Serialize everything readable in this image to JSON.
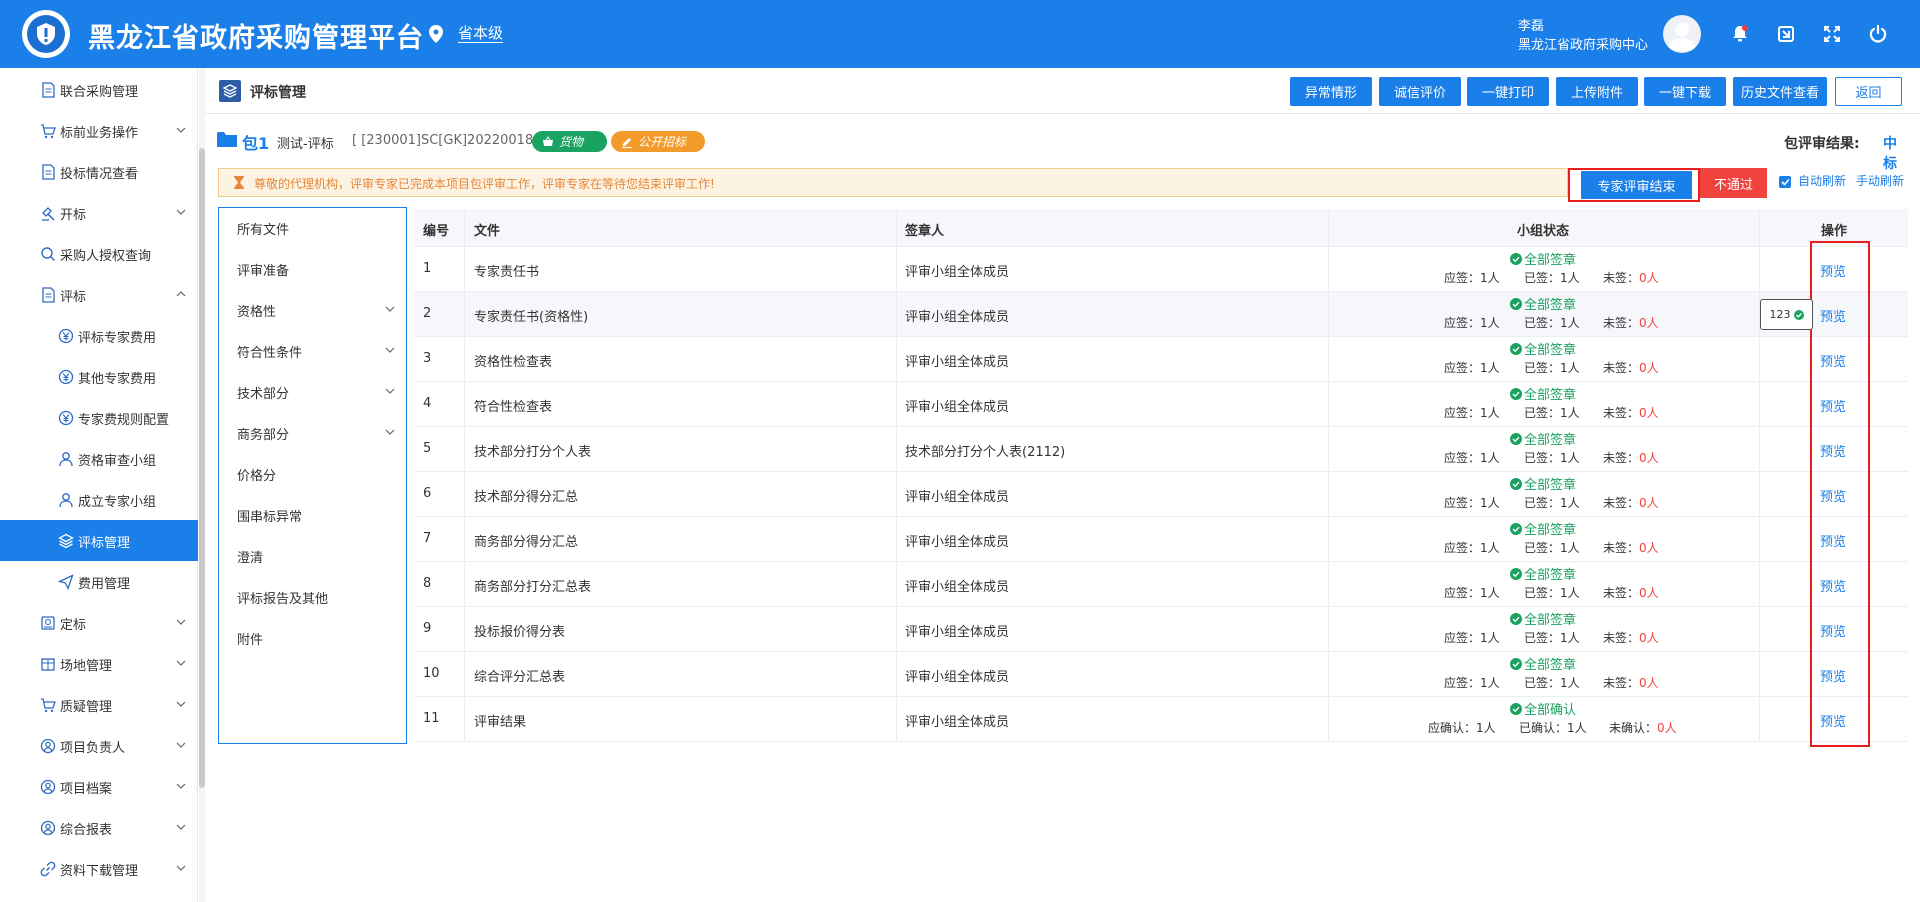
{
  "header": {
    "app_title": "黑龙江省政府采购管理平台",
    "location": "省本级",
    "user_name": "李磊",
    "user_org": "黑龙江省政府采购中心"
  },
  "sidebar": {
    "items": [
      {
        "label": "联合采购管理",
        "icon": "document-icon",
        "has_chevron": false
      },
      {
        "label": "标前业务操作",
        "icon": "cart-icon",
        "has_chevron": true
      },
      {
        "label": "投标情况查看",
        "icon": "document-icon",
        "has_chevron": false
      },
      {
        "label": "开标",
        "icon": "hammer-icon",
        "has_chevron": true
      },
      {
        "label": "采购人授权查询",
        "icon": "search-icon",
        "has_chevron": false
      },
      {
        "label": "评标",
        "icon": "document-icon",
        "has_chevron": true
      },
      {
        "label": "评标专家费用",
        "icon": "yen-icon",
        "has_chevron": false
      },
      {
        "label": "其他专家费用",
        "icon": "yen-icon",
        "has_chevron": false
      },
      {
        "label": "专家费规则配置",
        "icon": "yen-icon",
        "has_chevron": false
      },
      {
        "label": "资格审查小组",
        "icon": "user-icon",
        "has_chevron": false
      },
      {
        "label": "成立专家小组",
        "icon": "user-icon",
        "has_chevron": false
      },
      {
        "label": "评标管理",
        "icon": "layers-icon",
        "has_chevron": false
      },
      {
        "label": "费用管理",
        "icon": "send-icon",
        "has_chevron": false
      },
      {
        "label": "定标",
        "icon": "stamp-icon",
        "has_chevron": true
      },
      {
        "label": "场地管理",
        "icon": "building-icon",
        "has_chevron": true
      },
      {
        "label": "质疑管理",
        "icon": "cart-icon",
        "has_chevron": true
      },
      {
        "label": "项目负责人",
        "icon": "user-circle-icon",
        "has_chevron": true
      },
      {
        "label": "项目档案",
        "icon": "user-circle-icon",
        "has_chevron": true
      },
      {
        "label": "综合报表",
        "icon": "user-circle-icon",
        "has_chevron": true
      },
      {
        "label": "资料下载管理",
        "icon": "link-icon",
        "has_chevron": true
      }
    ]
  },
  "topbar": {
    "title": "评标管理",
    "buttons": [
      "异常情形",
      "诚信评价",
      "一键打印",
      "上传附件",
      "一键下载",
      "历史文件查看"
    ],
    "back_label": "返回"
  },
  "package": {
    "number": "包1",
    "name": "测试-评标",
    "code": "[ [230001]SC[GK]20220018 ]",
    "tag_goods": "货物",
    "tag_method": "公开招标",
    "result_label": "包评审结果:",
    "result_value": "中标"
  },
  "notice": {
    "text": "尊敬的代理机构，评审专家已完成本项目包评审工作，评审专家在等待您结束评审工作!",
    "end_button": "专家评审结束",
    "fail_button": "不通过",
    "auto_refresh": "自动刷新",
    "manual_refresh": "手动刷新"
  },
  "categories": [
    {
      "label": "所有文件",
      "has_chevron": false
    },
    {
      "label": "评审准备",
      "has_chevron": false
    },
    {
      "label": "资格性",
      "has_chevron": true
    },
    {
      "label": "符合性条件",
      "has_chevron": true
    },
    {
      "label": "技术部分",
      "has_chevron": true
    },
    {
      "label": "商务部分",
      "has_chevron": true
    },
    {
      "label": "价格分",
      "has_chevron": false
    },
    {
      "label": "围串标异常",
      "has_chevron": false
    },
    {
      "label": "澄清",
      "has_chevron": false
    },
    {
      "label": "评标报告及其他",
      "has_chevron": false
    },
    {
      "label": "附件",
      "has_chevron": false
    }
  ],
  "table": {
    "headers": [
      "编号",
      "文件",
      "签章人",
      "小组状态",
      "操作"
    ],
    "rows": [
      {
        "no": "1",
        "file": "专家责任书",
        "signer": "评审小组全体成员",
        "status": "全部签章",
        "due_label": "应签：",
        "due": "1人",
        "done_label": "已签：",
        "done": "1人",
        "left_label": "未签：",
        "left": "0人",
        "action": "预览"
      },
      {
        "no": "2",
        "file": "专家责任书(资格性)",
        "signer": "评审小组全体成员",
        "status": "全部签章",
        "due_label": "应签：",
        "due": "1人",
        "done_label": "已签：",
        "done": "1人",
        "left_label": "未签：",
        "left": "0人",
        "action": "预览"
      },
      {
        "no": "3",
        "file": "资格性检查表",
        "signer": "评审小组全体成员",
        "status": "全部签章",
        "due_label": "应签：",
        "due": "1人",
        "done_label": "已签：",
        "done": "1人",
        "left_label": "未签：",
        "left": "0人",
        "action": "预览"
      },
      {
        "no": "4",
        "file": "符合性检查表",
        "signer": "评审小组全体成员",
        "status": "全部签章",
        "due_label": "应签：",
        "due": "1人",
        "done_label": "已签：",
        "done": "1人",
        "left_label": "未签：",
        "left": "0人",
        "action": "预览"
      },
      {
        "no": "5",
        "file": "技术部分打分个人表",
        "signer": "技术部分打分个人表(2112)",
        "status": "全部签章",
        "due_label": "应签：",
        "due": "1人",
        "done_label": "已签：",
        "done": "1人",
        "left_label": "未签：",
        "left": "0人",
        "action": "预览"
      },
      {
        "no": "6",
        "file": "技术部分得分汇总",
        "signer": "评审小组全体成员",
        "status": "全部签章",
        "due_label": "应签：",
        "due": "1人",
        "done_label": "已签：",
        "done": "1人",
        "left_label": "未签：",
        "left": "0人",
        "action": "预览"
      },
      {
        "no": "7",
        "file": "商务部分得分汇总",
        "signer": "评审小组全体成员",
        "status": "全部签章",
        "due_label": "应签：",
        "due": "1人",
        "done_label": "已签：",
        "done": "1人",
        "left_label": "未签：",
        "left": "0人",
        "action": "预览"
      },
      {
        "no": "8",
        "file": "商务部分打分汇总表",
        "signer": "评审小组全体成员",
        "status": "全部签章",
        "due_label": "应签：",
        "due": "1人",
        "done_label": "已签：",
        "done": "1人",
        "left_label": "未签：",
        "left": "0人",
        "action": "预览"
      },
      {
        "no": "9",
        "file": "投标报价得分表",
        "signer": "评审小组全体成员",
        "status": "全部签章",
        "due_label": "应签：",
        "due": "1人",
        "done_label": "已签：",
        "done": "1人",
        "left_label": "未签：",
        "left": "0人",
        "action": "预览"
      },
      {
        "no": "10",
        "file": "综合评分汇总表",
        "signer": "评审小组全体成员",
        "status": "全部签章",
        "due_label": "应签：",
        "due": "1人",
        "done_label": "已签：",
        "done": "1人",
        "left_label": "未签：",
        "left": "0人",
        "action": "预览"
      },
      {
        "no": "11",
        "file": "评审结果",
        "signer": "评审小组全体成员",
        "status": "全部确认",
        "due_label": "应确认：",
        "due": "1人",
        "done_label": "已确认：",
        "done": "1人",
        "left_label": "未确认：",
        "left": "0人",
        "action": "预览"
      }
    ]
  },
  "tooltip": {
    "text": "123"
  },
  "colors": {
    "primary": "#1a7fe8",
    "success": "#1aa260",
    "danger": "#f0433d",
    "warning": "#e6873a",
    "highlight_box": "#e81e1e"
  }
}
